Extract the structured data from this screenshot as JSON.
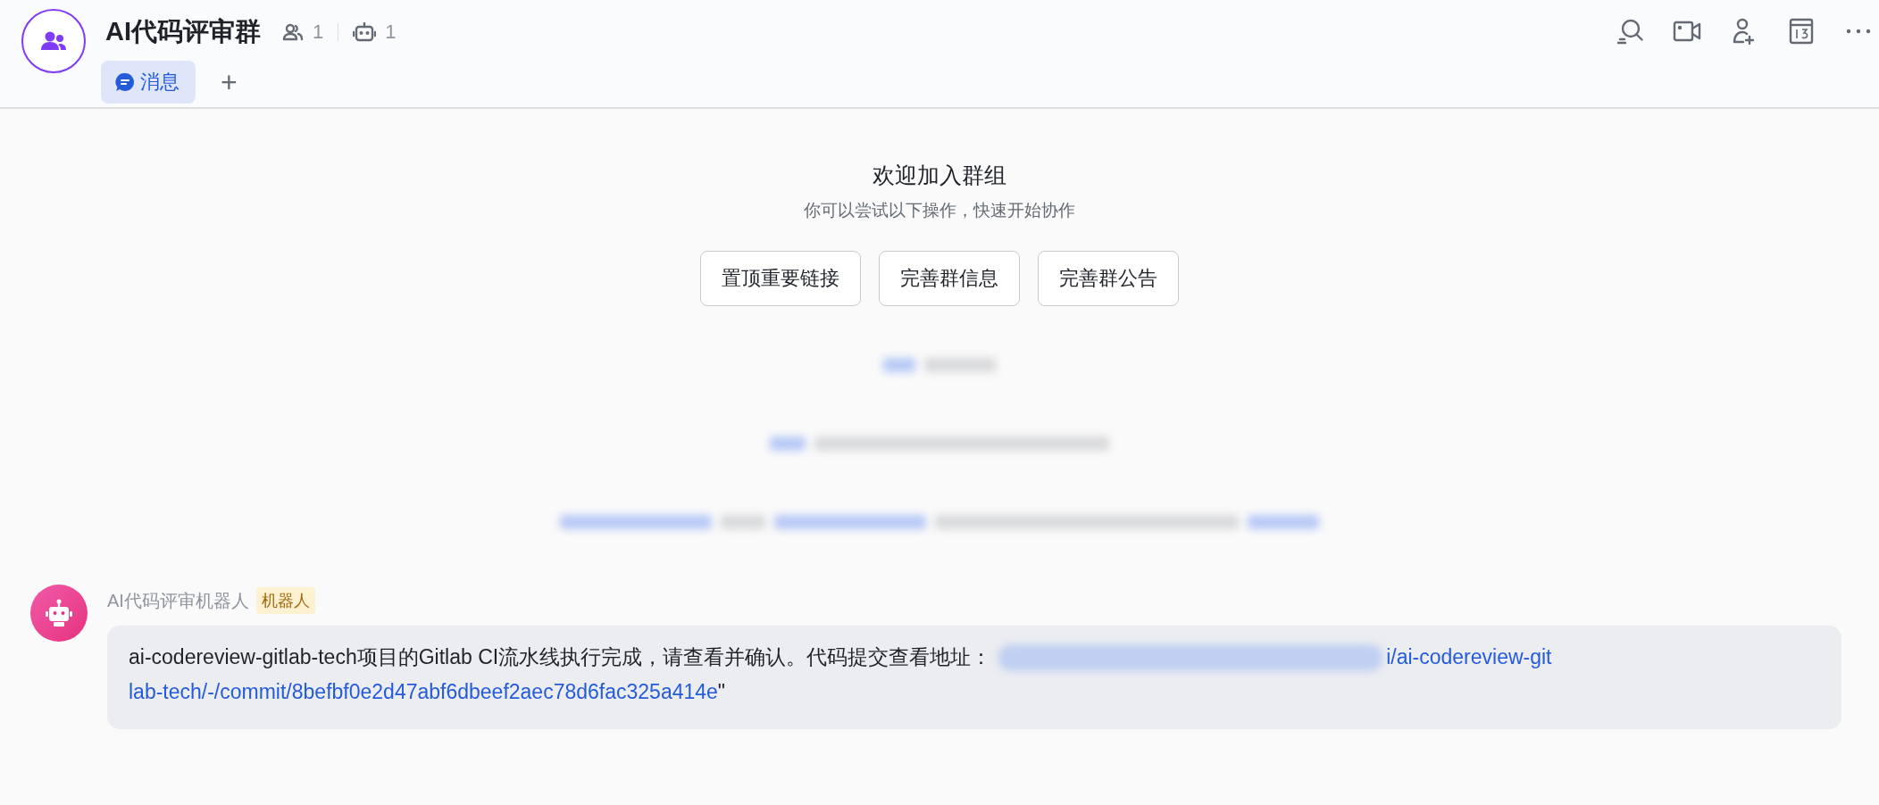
{
  "header": {
    "title": "AI代码评审群",
    "member_count": "1",
    "bot_count": "1",
    "tabs": [
      {
        "label": "消息",
        "selected": true
      }
    ],
    "add_tab": "+"
  },
  "welcome": {
    "title": "欢迎加入群组",
    "subtitle": "你可以尝试以下操作，快速开始协作",
    "actions": [
      "置顶重要链接",
      "完善群信息",
      "完善群公告"
    ]
  },
  "messages": [
    {
      "sender": "AI代码评审机器人",
      "badge": "机器人",
      "text": "ai-codereview-gitlab-tech项目的Gitlab CI流水线执行完成，请查看并确认。代码提交查看地址：",
      "link_lines": [
        "i/ai-codereview-git",
        "lab-tech/-/commit/8befbf0e2d47abf6dbeef2aec78d6fac325a414e"
      ],
      "after": "\""
    }
  ]
}
